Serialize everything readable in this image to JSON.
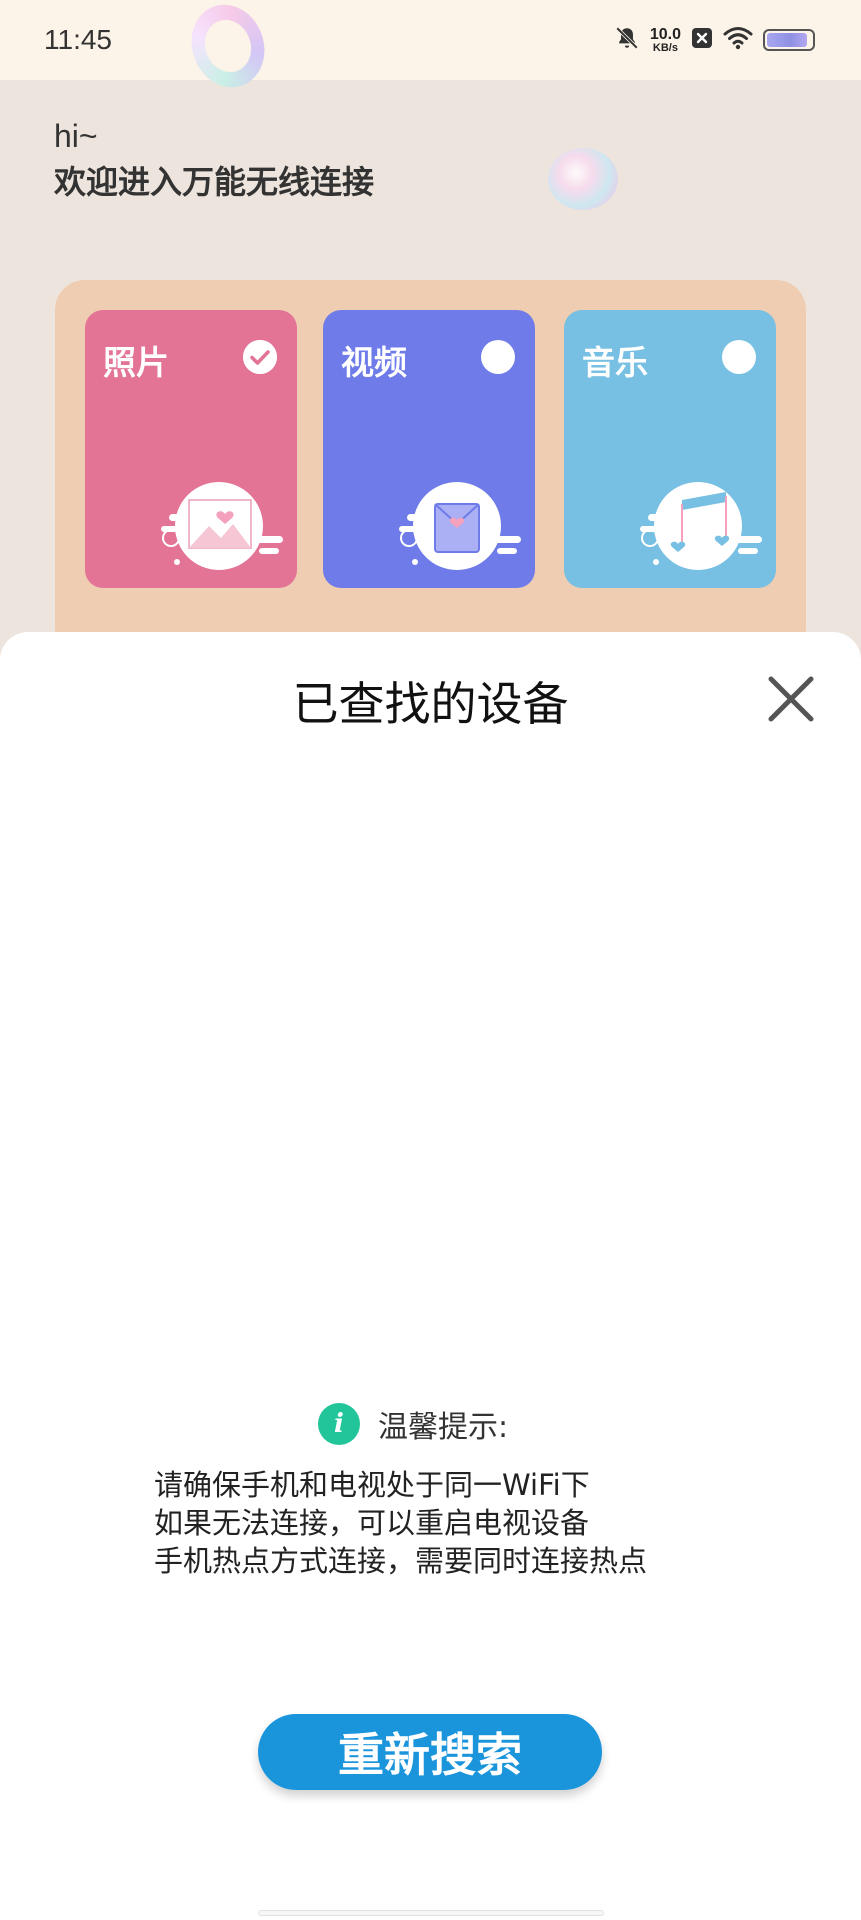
{
  "status_bar": {
    "time": "11:45",
    "net_speed_value": "10.0",
    "net_speed_unit": "KB/s",
    "icons": [
      "bell-off-icon",
      "network-speed",
      "notification-x-icon",
      "wifi-icon",
      "battery-icon"
    ],
    "battery_level": 0.9
  },
  "greeting": {
    "hi": "hi~",
    "welcome": "欢迎进入万能无线连接"
  },
  "media_types": [
    {
      "label": "照片",
      "selected": true,
      "color": "#e37496",
      "icon": "photo-icon"
    },
    {
      "label": "视频",
      "selected": false,
      "color": "#6e7be8",
      "icon": "video-icon"
    },
    {
      "label": "音乐",
      "selected": false,
      "color": "#78c0e3",
      "icon": "music-icon"
    }
  ],
  "sheet": {
    "title": "已查找的设备",
    "tip_title": "温馨提示:",
    "tip_icon": "i",
    "tips": [
      "请确保手机和电视处于同一WiFi下",
      "如果无法连接，可以重启电视设备",
      "手机热点方式连接，需要同时连接热点"
    ],
    "button_label": "重新搜索"
  },
  "colors": {
    "accent_button": "#1a95dc",
    "tip_icon": "#22c59a",
    "panel": "#efcdb2"
  }
}
